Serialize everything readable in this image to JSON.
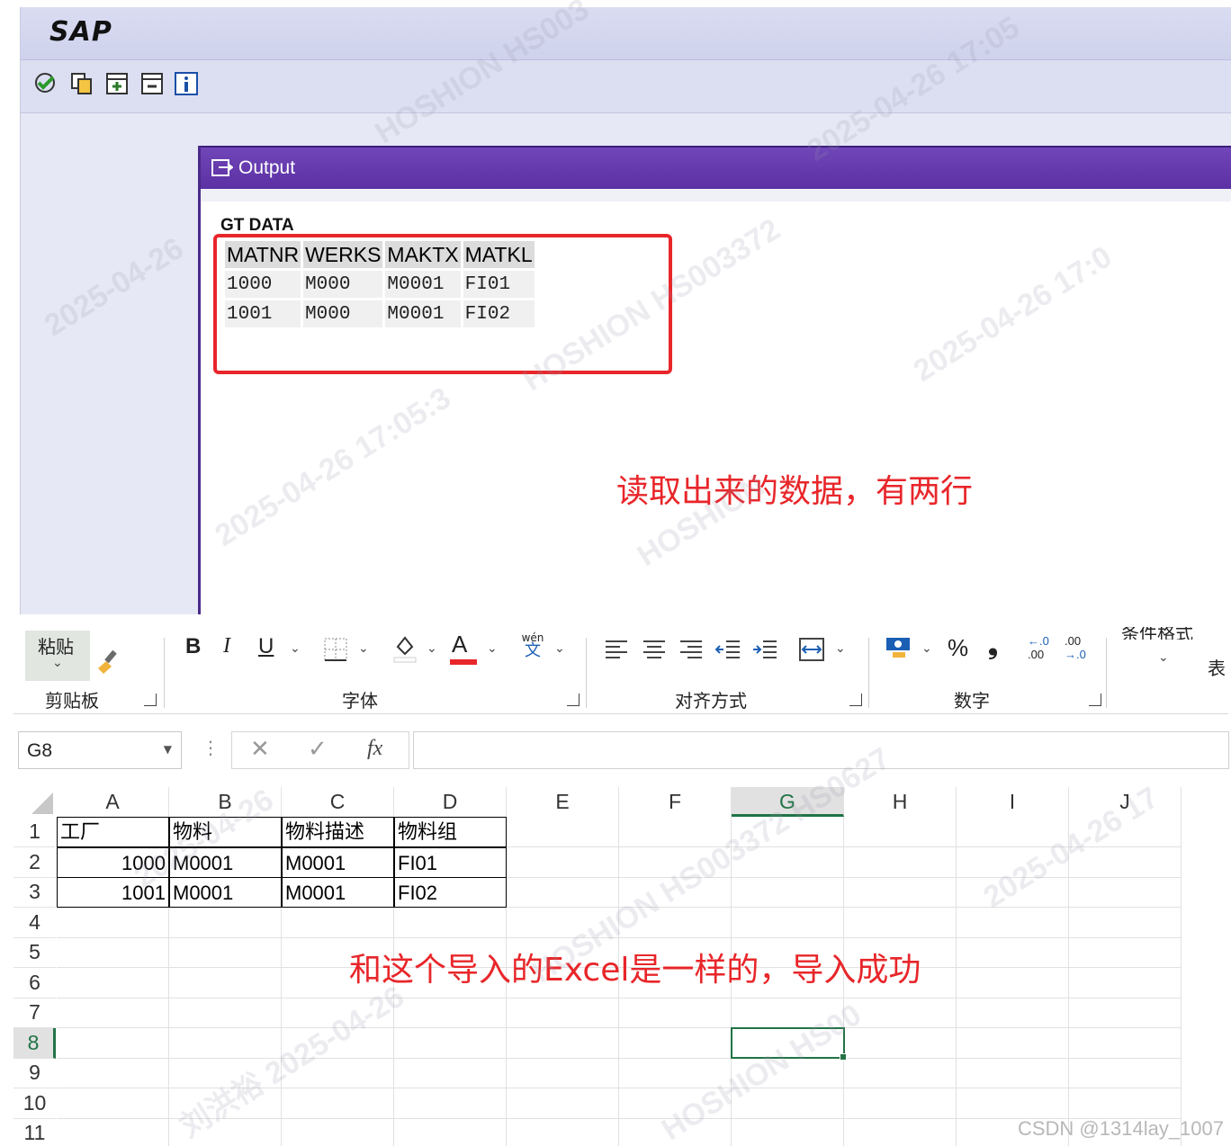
{
  "sap": {
    "logo": "SAP",
    "toolbar_icons": [
      "execute-icon",
      "copy-icon",
      "insert-icon",
      "delete-icon",
      "info-icon"
    ],
    "output_window": {
      "title": "Output",
      "section_label": "GT DATA",
      "columns": [
        "MATNR",
        "WERKS",
        "MAKTX",
        "MATKL"
      ],
      "rows": [
        [
          "1000",
          "M000",
          "M0001",
          "FI01"
        ],
        [
          "1001",
          "M000",
          "M0001",
          "FI02"
        ]
      ]
    },
    "annotation": "读取出来的数据，有两行"
  },
  "excel": {
    "ribbon": {
      "paste_label": "粘贴",
      "clipboard_group": "剪贴板",
      "font_group": "字体",
      "alignment_group": "对齐方式",
      "number_group": "数字",
      "conditional_format": "条件格式",
      "table_partial": "表",
      "bold": "B",
      "italic": "I",
      "underline": "U",
      "font_color": "A",
      "wen": "wén",
      "wen_char": "文",
      "percent": "%",
      "comma": "❟",
      "inc_decimal_top": "←.0",
      "inc_decimal_bottom": ".00",
      "dec_decimal_top": ".00",
      "dec_decimal_bottom": "→.0",
      "colors": {
        "font_color_bar": "#e8262a",
        "fill_bar": "#ffffff"
      }
    },
    "formula_bar": {
      "name_box": "G8",
      "fx": "fx",
      "value": ""
    },
    "columns": [
      "A",
      "B",
      "C",
      "D",
      "E",
      "F",
      "G",
      "H",
      "I",
      "J"
    ],
    "row_numbers": [
      "1",
      "2",
      "3",
      "4",
      "5",
      "6",
      "7",
      "8",
      "9",
      "10",
      "11"
    ],
    "sheet": {
      "header": [
        "工厂",
        "物料",
        "物料描述",
        "物料组"
      ],
      "rows": [
        [
          "1000",
          "M0001",
          "M0001",
          "FI01"
        ],
        [
          "1001",
          "M0001",
          "M0001",
          "FI02"
        ]
      ]
    },
    "selected_cell": "G8",
    "annotation": "和这个导入的Excel是一样的，导入成功"
  },
  "credit": "CSDN @1314lay_1007",
  "colors": {
    "sap_title_purple": "#5b2fa2",
    "annotation_red": "#e8262a",
    "excel_select_green": "#217346"
  }
}
